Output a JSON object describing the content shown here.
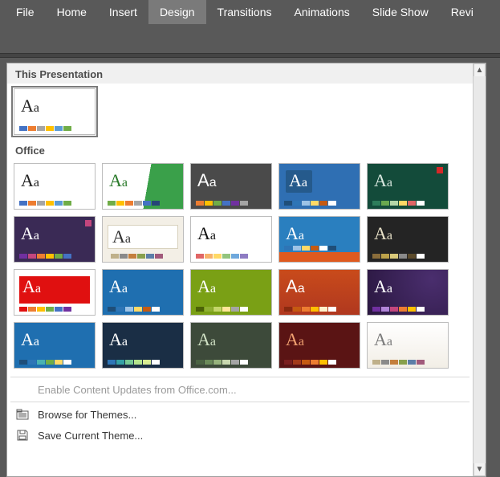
{
  "ribbon": {
    "tabs": [
      {
        "label": "File",
        "active": false
      },
      {
        "label": "Home",
        "active": false
      },
      {
        "label": "Insert",
        "active": false
      },
      {
        "label": "Design",
        "active": true
      },
      {
        "label": "Transitions",
        "active": false
      },
      {
        "label": "Animations",
        "active": false
      },
      {
        "label": "Slide Show",
        "active": false
      },
      {
        "label": "Revi",
        "active": false
      }
    ]
  },
  "themes_panel": {
    "section_this": "This Presentation",
    "section_office": "Office",
    "current_theme_label": "Aa",
    "menu": {
      "enable_updates": "Enable Content Updates from Office.com...",
      "browse": "Browse for Themes...",
      "save": "Save Current Theme..."
    }
  }
}
